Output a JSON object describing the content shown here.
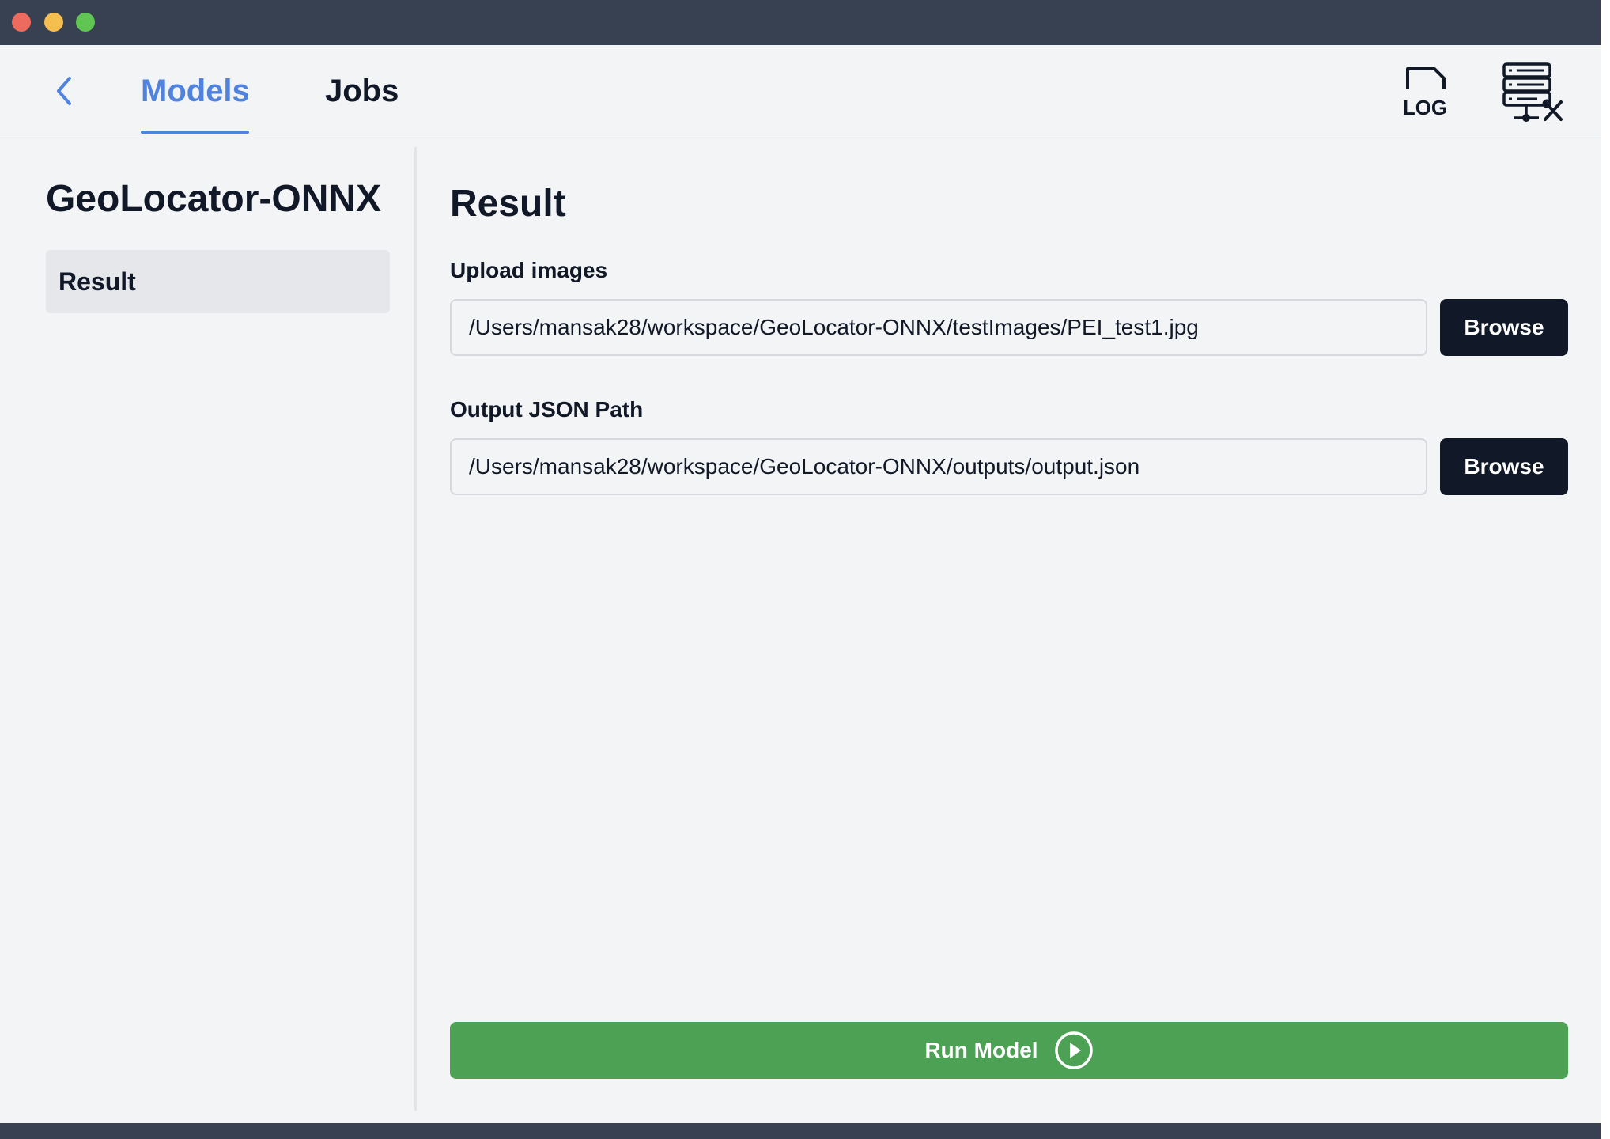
{
  "window": {
    "traffic_lights": [
      "close",
      "minimize",
      "maximize"
    ]
  },
  "nav": {
    "back_icon": "chevron-left-icon",
    "tabs": [
      {
        "label": "Models",
        "active": true
      },
      {
        "label": "Jobs",
        "active": false
      }
    ],
    "log_icon_label": "LOG",
    "server_icon": "server-tools-icon",
    "accent_color": "#4f83de"
  },
  "sidebar": {
    "model_name": "GeoLocator-ONNX",
    "items": [
      {
        "label": "Result",
        "selected": true
      }
    ]
  },
  "main": {
    "title": "Result",
    "fields": [
      {
        "label": "Upload images",
        "value": "/Users/mansak28/workspace/GeoLocator-ONNX/testImages/PEI_test1.jpg",
        "button": "Browse"
      },
      {
        "label": "Output JSON Path",
        "value": "/Users/mansak28/workspace/GeoLocator-ONNX/outputs/output.json",
        "button": "Browse"
      }
    ],
    "run_button": {
      "label": "Run Model",
      "icon": "play-circle-icon",
      "color": "#4ca154"
    }
  }
}
